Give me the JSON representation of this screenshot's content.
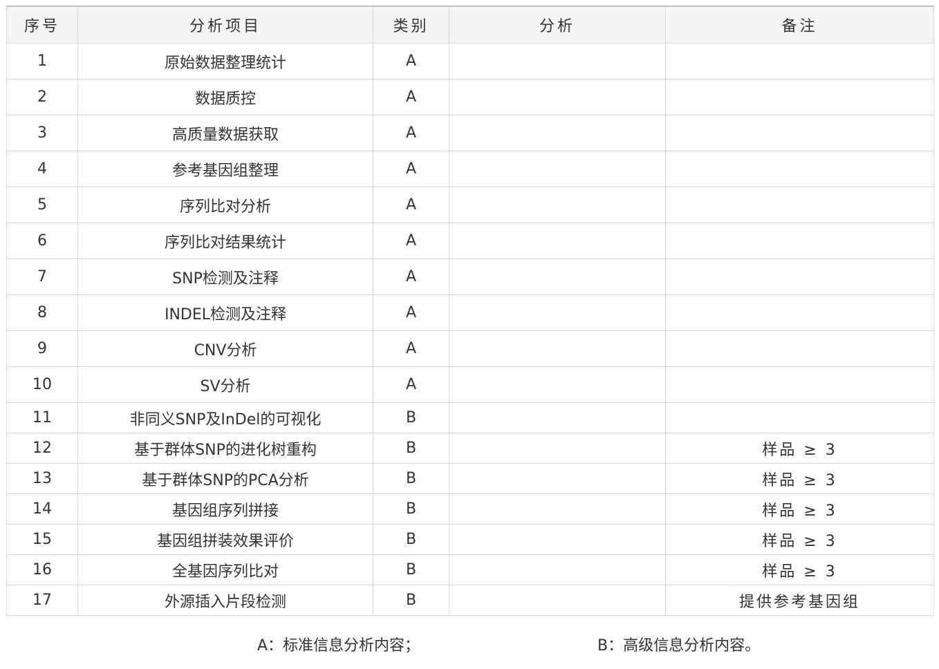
{
  "table": {
    "headers": [
      "序号",
      "分析项目",
      "类别",
      "分析",
      "备注"
    ],
    "rows": [
      {
        "no": "1",
        "item": "原始数据整理统计",
        "cat": "A",
        "analysis": "",
        "note": ""
      },
      {
        "no": "2",
        "item": "数据质控",
        "cat": "A",
        "analysis": "",
        "note": ""
      },
      {
        "no": "3",
        "item": "高质量数据获取",
        "cat": "A",
        "analysis": "",
        "note": ""
      },
      {
        "no": "4",
        "item": "参考基因组整理",
        "cat": "A",
        "analysis": "",
        "note": ""
      },
      {
        "no": "5",
        "item": "序列比对分析",
        "cat": "A",
        "analysis": "",
        "note": ""
      },
      {
        "no": "6",
        "item": "序列比对结果统计",
        "cat": "A",
        "analysis": "",
        "note": ""
      },
      {
        "no": "7",
        "item": "SNP检测及注释",
        "cat": "A",
        "analysis": "",
        "note": ""
      },
      {
        "no": "8",
        "item": "INDEL检测及注释",
        "cat": "A",
        "analysis": "",
        "note": ""
      },
      {
        "no": "9",
        "item": "CNV分析",
        "cat": "A",
        "analysis": "",
        "note": ""
      },
      {
        "no": "10",
        "item": "SV分析",
        "cat": "A",
        "analysis": "",
        "note": ""
      },
      {
        "no": "11",
        "item": "非同义SNP及InDel的可视化",
        "cat": "B",
        "analysis": "",
        "note": ""
      },
      {
        "no": "12",
        "item": "基于群体SNP的进化树重构",
        "cat": "B",
        "analysis": "",
        "note": "样品 ≥ 3"
      },
      {
        "no": "13",
        "item": "基于群体SNP的PCA分析",
        "cat": "B",
        "analysis": "",
        "note": "样品 ≥ 3"
      },
      {
        "no": "14",
        "item": "基因组序列拼接",
        "cat": "B",
        "analysis": "",
        "note": "样品 ≥ 3"
      },
      {
        "no": "15",
        "item": "基因组拼装效果评价",
        "cat": "B",
        "analysis": "",
        "note": "样品 ≥ 3"
      },
      {
        "no": "16",
        "item": "全基因序列比对",
        "cat": "B",
        "analysis": "",
        "note": "样品 ≥ 3"
      },
      {
        "no": "17",
        "item": "外源插入片段检测",
        "cat": "B",
        "analysis": "",
        "note": "提供参考基因组"
      }
    ]
  },
  "legend": {
    "a": "A：标准信息分析内容；",
    "b": "B：高级信息分析内容。"
  },
  "colors": {
    "border": "#d8d8d8",
    "header_bg": "#f5f5f5",
    "text": "#333333"
  }
}
